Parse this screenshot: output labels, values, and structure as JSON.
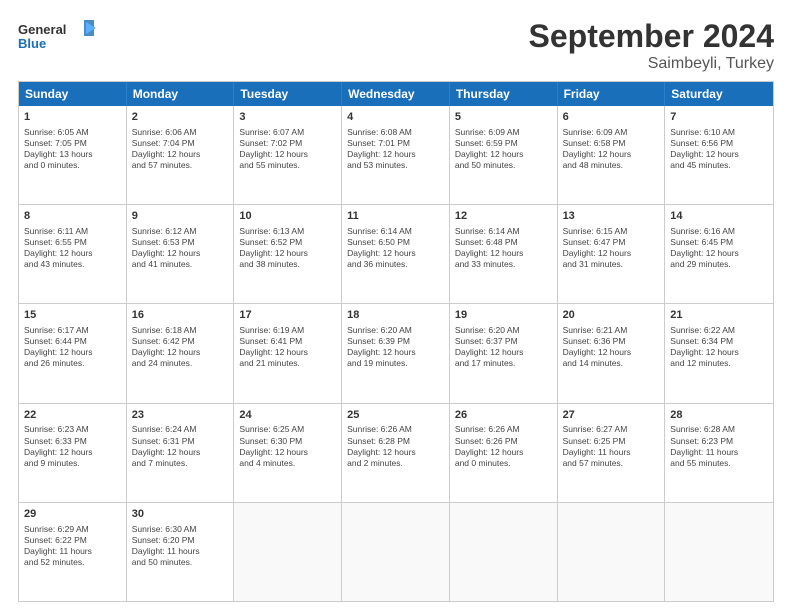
{
  "logo": {
    "line1": "General",
    "line2": "Blue"
  },
  "title": "September 2024",
  "subtitle": "Saimbeyli, Turkey",
  "header_days": [
    "Sunday",
    "Monday",
    "Tuesday",
    "Wednesday",
    "Thursday",
    "Friday",
    "Saturday"
  ],
  "weeks": [
    [
      {
        "day": "1",
        "lines": [
          "Sunrise: 6:05 AM",
          "Sunset: 7:05 PM",
          "Daylight: 13 hours",
          "and 0 minutes."
        ]
      },
      {
        "day": "2",
        "lines": [
          "Sunrise: 6:06 AM",
          "Sunset: 7:04 PM",
          "Daylight: 12 hours",
          "and 57 minutes."
        ]
      },
      {
        "day": "3",
        "lines": [
          "Sunrise: 6:07 AM",
          "Sunset: 7:02 PM",
          "Daylight: 12 hours",
          "and 55 minutes."
        ]
      },
      {
        "day": "4",
        "lines": [
          "Sunrise: 6:08 AM",
          "Sunset: 7:01 PM",
          "Daylight: 12 hours",
          "and 53 minutes."
        ]
      },
      {
        "day": "5",
        "lines": [
          "Sunrise: 6:09 AM",
          "Sunset: 6:59 PM",
          "Daylight: 12 hours",
          "and 50 minutes."
        ]
      },
      {
        "day": "6",
        "lines": [
          "Sunrise: 6:09 AM",
          "Sunset: 6:58 PM",
          "Daylight: 12 hours",
          "and 48 minutes."
        ]
      },
      {
        "day": "7",
        "lines": [
          "Sunrise: 6:10 AM",
          "Sunset: 6:56 PM",
          "Daylight: 12 hours",
          "and 45 minutes."
        ]
      }
    ],
    [
      {
        "day": "8",
        "lines": [
          "Sunrise: 6:11 AM",
          "Sunset: 6:55 PM",
          "Daylight: 12 hours",
          "and 43 minutes."
        ]
      },
      {
        "day": "9",
        "lines": [
          "Sunrise: 6:12 AM",
          "Sunset: 6:53 PM",
          "Daylight: 12 hours",
          "and 41 minutes."
        ]
      },
      {
        "day": "10",
        "lines": [
          "Sunrise: 6:13 AM",
          "Sunset: 6:52 PM",
          "Daylight: 12 hours",
          "and 38 minutes."
        ]
      },
      {
        "day": "11",
        "lines": [
          "Sunrise: 6:14 AM",
          "Sunset: 6:50 PM",
          "Daylight: 12 hours",
          "and 36 minutes."
        ]
      },
      {
        "day": "12",
        "lines": [
          "Sunrise: 6:14 AM",
          "Sunset: 6:48 PM",
          "Daylight: 12 hours",
          "and 33 minutes."
        ]
      },
      {
        "day": "13",
        "lines": [
          "Sunrise: 6:15 AM",
          "Sunset: 6:47 PM",
          "Daylight: 12 hours",
          "and 31 minutes."
        ]
      },
      {
        "day": "14",
        "lines": [
          "Sunrise: 6:16 AM",
          "Sunset: 6:45 PM",
          "Daylight: 12 hours",
          "and 29 minutes."
        ]
      }
    ],
    [
      {
        "day": "15",
        "lines": [
          "Sunrise: 6:17 AM",
          "Sunset: 6:44 PM",
          "Daylight: 12 hours",
          "and 26 minutes."
        ]
      },
      {
        "day": "16",
        "lines": [
          "Sunrise: 6:18 AM",
          "Sunset: 6:42 PM",
          "Daylight: 12 hours",
          "and 24 minutes."
        ]
      },
      {
        "day": "17",
        "lines": [
          "Sunrise: 6:19 AM",
          "Sunset: 6:41 PM",
          "Daylight: 12 hours",
          "and 21 minutes."
        ]
      },
      {
        "day": "18",
        "lines": [
          "Sunrise: 6:20 AM",
          "Sunset: 6:39 PM",
          "Daylight: 12 hours",
          "and 19 minutes."
        ]
      },
      {
        "day": "19",
        "lines": [
          "Sunrise: 6:20 AM",
          "Sunset: 6:37 PM",
          "Daylight: 12 hours",
          "and 17 minutes."
        ]
      },
      {
        "day": "20",
        "lines": [
          "Sunrise: 6:21 AM",
          "Sunset: 6:36 PM",
          "Daylight: 12 hours",
          "and 14 minutes."
        ]
      },
      {
        "day": "21",
        "lines": [
          "Sunrise: 6:22 AM",
          "Sunset: 6:34 PM",
          "Daylight: 12 hours",
          "and 12 minutes."
        ]
      }
    ],
    [
      {
        "day": "22",
        "lines": [
          "Sunrise: 6:23 AM",
          "Sunset: 6:33 PM",
          "Daylight: 12 hours",
          "and 9 minutes."
        ]
      },
      {
        "day": "23",
        "lines": [
          "Sunrise: 6:24 AM",
          "Sunset: 6:31 PM",
          "Daylight: 12 hours",
          "and 7 minutes."
        ]
      },
      {
        "day": "24",
        "lines": [
          "Sunrise: 6:25 AM",
          "Sunset: 6:30 PM",
          "Daylight: 12 hours",
          "and 4 minutes."
        ]
      },
      {
        "day": "25",
        "lines": [
          "Sunrise: 6:26 AM",
          "Sunset: 6:28 PM",
          "Daylight: 12 hours",
          "and 2 minutes."
        ]
      },
      {
        "day": "26",
        "lines": [
          "Sunrise: 6:26 AM",
          "Sunset: 6:26 PM",
          "Daylight: 12 hours",
          "and 0 minutes."
        ]
      },
      {
        "day": "27",
        "lines": [
          "Sunrise: 6:27 AM",
          "Sunset: 6:25 PM",
          "Daylight: 11 hours",
          "and 57 minutes."
        ]
      },
      {
        "day": "28",
        "lines": [
          "Sunrise: 6:28 AM",
          "Sunset: 6:23 PM",
          "Daylight: 11 hours",
          "and 55 minutes."
        ]
      }
    ],
    [
      {
        "day": "29",
        "lines": [
          "Sunrise: 6:29 AM",
          "Sunset: 6:22 PM",
          "Daylight: 11 hours",
          "and 52 minutes."
        ]
      },
      {
        "day": "30",
        "lines": [
          "Sunrise: 6:30 AM",
          "Sunset: 6:20 PM",
          "Daylight: 11 hours",
          "and 50 minutes."
        ]
      },
      {
        "day": "",
        "lines": []
      },
      {
        "day": "",
        "lines": []
      },
      {
        "day": "",
        "lines": []
      },
      {
        "day": "",
        "lines": []
      },
      {
        "day": "",
        "lines": []
      }
    ]
  ]
}
